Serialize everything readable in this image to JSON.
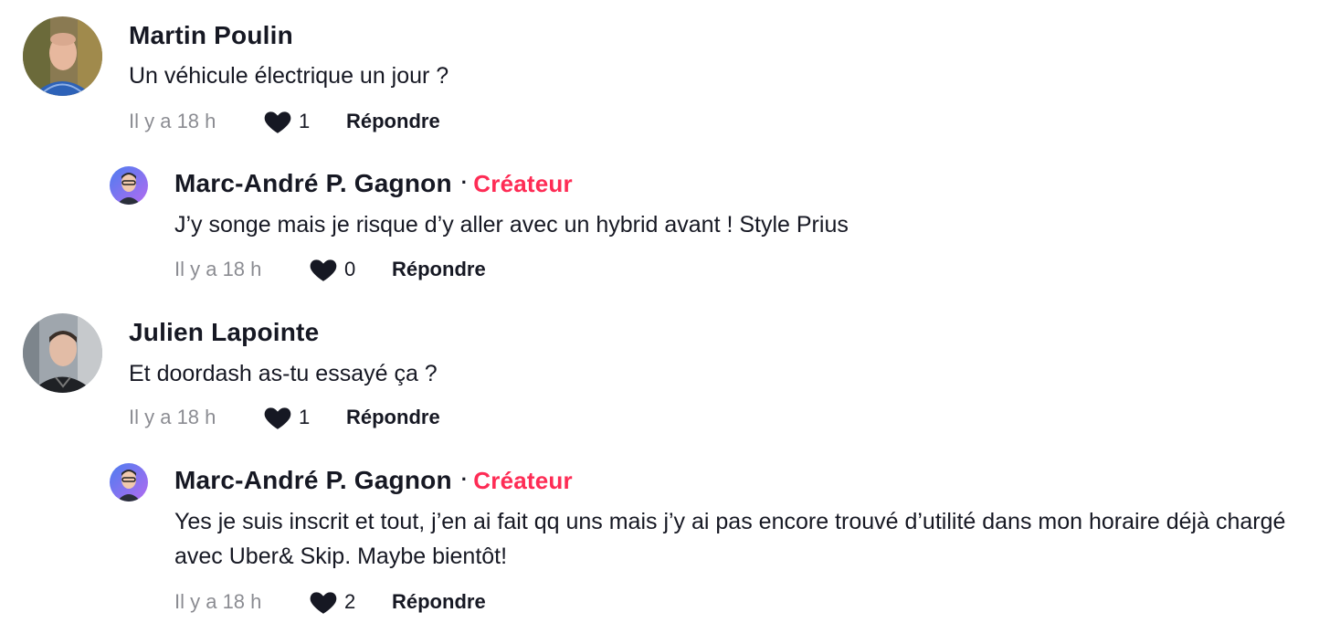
{
  "comments": [
    {
      "author": "Martin Poulin",
      "text": "Un véhicule électrique un jour ?",
      "time": "Il y a 18 h",
      "likes": "1",
      "reply_label": "Répondre",
      "avatar": "user-photo-man-blue-shirt"
    },
    {
      "author": "Marc-André P. Gagnon",
      "separator": "·",
      "badge": "Créateur",
      "text": "J’y songe mais je risque d’y aller avec un hybrid avant ! Style Prius",
      "time": "Il y a 18 h",
      "likes": "0",
      "reply_label": "Répondre",
      "avatar": "creator-avatar-illustrated"
    },
    {
      "author": "Julien Lapointe",
      "text": "Et doordash as-tu essayé ça ?",
      "time": "Il y a 18 h",
      "likes": "1",
      "reply_label": "Répondre",
      "avatar": "user-photo-man-dark-shirt"
    },
    {
      "author": "Marc-André P. Gagnon",
      "separator": "·",
      "badge": "Créateur",
      "text": "Yes je suis inscrit et tout, j’en ai fait qq uns mais j’y ai pas encore trouvé d’utilité dans mon horaire déjà chargé avec Uber& Skip. Maybe bientôt!",
      "time": "Il y a 18 h",
      "likes": "2",
      "reply_label": "Répondre",
      "avatar": "creator-avatar-illustrated"
    }
  ],
  "colors": {
    "creator_badge": "#fe2c55",
    "text": "#161823",
    "muted": "#8a8b91"
  }
}
